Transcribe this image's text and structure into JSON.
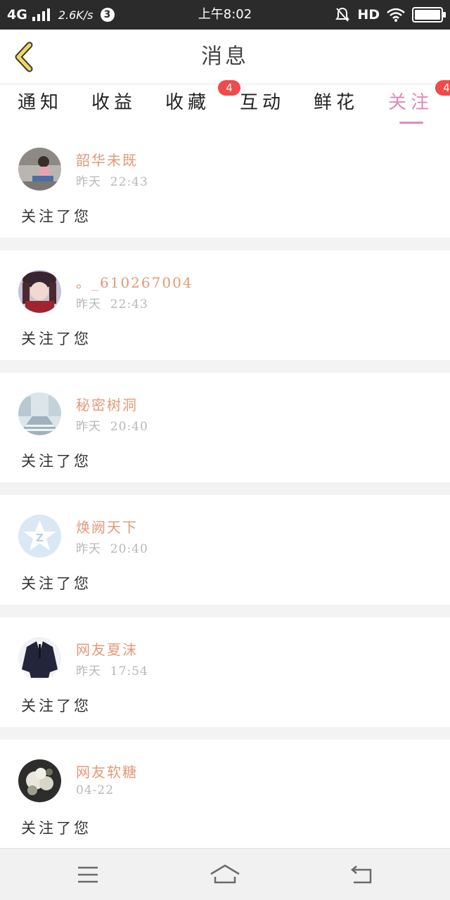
{
  "status_bar": {
    "network": "4G",
    "speed": "2.6K/s",
    "notification_count": "3",
    "time": "上午8:02",
    "hd": "HD"
  },
  "header": {
    "title": "消息",
    "back_icon": "chevron-left-icon"
  },
  "tabs": [
    {
      "label": "通知",
      "badge": "",
      "active": false
    },
    {
      "label": "收益",
      "badge": "",
      "active": false
    },
    {
      "label": "收藏",
      "badge": "4",
      "active": false
    },
    {
      "label": "互动",
      "badge": "",
      "active": false
    },
    {
      "label": "鲜花",
      "badge": "",
      "active": false
    },
    {
      "label": "关注",
      "badge": "4",
      "active": true
    }
  ],
  "notifications": [
    {
      "name": "韶华未既",
      "time": "昨天  22:43",
      "message": "关注了您",
      "avatar": "photo-girl-avatar"
    },
    {
      "name": "。_610267004",
      "time": "昨天  22:43",
      "message": "关注了您",
      "avatar": "photo-girl-avatar"
    },
    {
      "name": "秘密树洞",
      "time": "昨天  20:40",
      "message": "关注了您",
      "avatar": "street-photo-avatar"
    },
    {
      "name": "焕阙天下",
      "time": "昨天  20:40",
      "message": "关注了您",
      "avatar": "qq-default-avatar"
    },
    {
      "name": "网友夏沫",
      "time": "昨天  17:54",
      "message": "关注了您",
      "avatar": "jacket-photo-avatar"
    },
    {
      "name": "网友软糖",
      "time": "04-22",
      "message": "关注了您",
      "avatar": "flowers-photo-avatar"
    }
  ],
  "nav": {
    "menu_icon": "menu-icon",
    "home_icon": "home-icon",
    "back_icon": "back-icon"
  },
  "colors": {
    "accent_pink": "#e388b8",
    "name_orange": "#e29a78",
    "badge_red": "#f24a4a"
  }
}
